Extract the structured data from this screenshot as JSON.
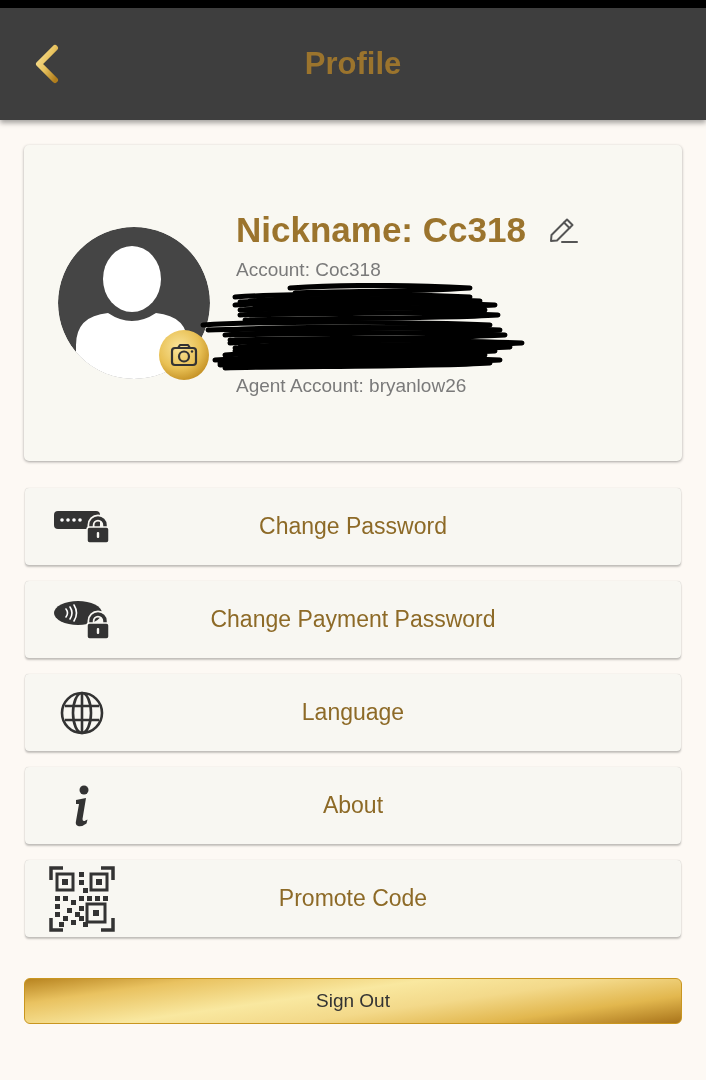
{
  "header": {
    "title": "Profile"
  },
  "profile": {
    "nickname": "Nickname: Cc318",
    "account": "Account: Coc318",
    "agent_account": "Agent Account: bryanlow26"
  },
  "menu": [
    {
      "kind": "password",
      "label": "Change Password"
    },
    {
      "kind": "payment_password",
      "label": "Change Payment Password"
    },
    {
      "kind": "language",
      "label": "Language"
    },
    {
      "kind": "about",
      "label": "About"
    },
    {
      "kind": "qr_code",
      "label": "Promote Code"
    }
  ],
  "sign_out": {
    "label": "Sign Out"
  }
}
